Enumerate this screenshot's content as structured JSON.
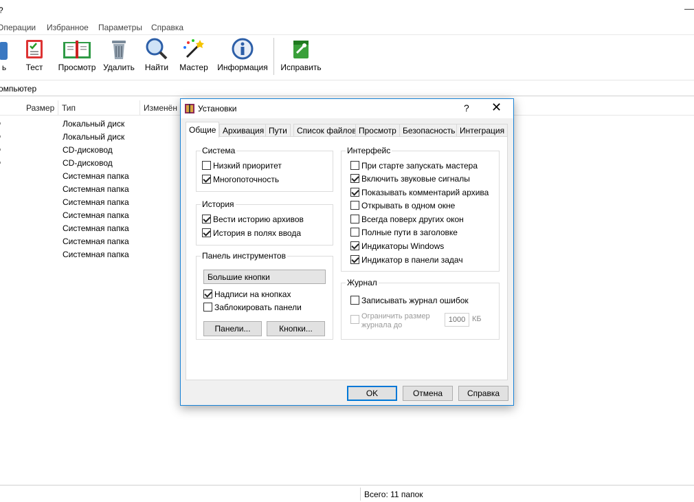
{
  "window": {
    "title_fragment": "?",
    "minimize_glyph": "—"
  },
  "menu": [
    "Операции",
    "Избранное",
    "Параметры",
    "Справка"
  ],
  "toolbar": {
    "partial_label": "ь",
    "buttons": [
      "Тест",
      "Просмотр",
      "Удалить",
      "Найти",
      "Мастер",
      "Информация",
      "Исправить"
    ]
  },
  "address": "омпьютер",
  "list": {
    "columns": [
      "Размер",
      "Тип",
      "Изменён"
    ],
    "rows": [
      "Локальный диск",
      "Локальный диск",
      "CD-дисковод",
      "CD-дисковод",
      "Системная папка",
      "Системная папка",
      "Системная папка",
      "Системная папка",
      "Системная папка",
      "Системная папка",
      "Системная папка"
    ]
  },
  "status": "Всего: 11 папок",
  "dialog": {
    "title": "Установки",
    "help": "?",
    "close": "✕",
    "tabs": [
      "Общие",
      "Архивация",
      "Пути",
      "Список файлов",
      "Просмотр",
      "Безопасность",
      "Интеграция"
    ],
    "active_tab": "Общие",
    "system": {
      "title": "Система",
      "options": [
        {
          "label": "Низкий приоритет",
          "checked": false
        },
        {
          "label": "Многопоточность",
          "checked": true
        }
      ]
    },
    "history": {
      "title": "История",
      "options": [
        {
          "label": "Вести историю архивов",
          "checked": true
        },
        {
          "label": "История в полях ввода",
          "checked": true
        }
      ]
    },
    "toolbar_panel": {
      "title": "Панель инструментов",
      "select_value": "Большие кнопки",
      "options": [
        {
          "label": "Надписи на кнопках",
          "checked": true
        },
        {
          "label": "Заблокировать панели",
          "checked": false
        }
      ],
      "panels_button": "Панели...",
      "buttons_button": "Кнопки..."
    },
    "interface": {
      "title": "Интерфейс",
      "options": [
        {
          "label": "При старте запускать мастера",
          "checked": false
        },
        {
          "label": "Включить звуковые сигналы",
          "checked": true
        },
        {
          "label": "Показывать комментарий архива",
          "checked": true
        },
        {
          "label": "Открывать в одном окне",
          "checked": false
        },
        {
          "label": "Всегда поверх других окон",
          "checked": false
        },
        {
          "label": "Полные пути в заголовке",
          "checked": false
        },
        {
          "label": "Индикаторы Windows",
          "checked": true
        },
        {
          "label": "Индикатор в панели задач",
          "checked": true
        }
      ]
    },
    "log": {
      "title": "Журнал",
      "write_log": {
        "label": "Записывать журнал ошибок",
        "checked": false
      },
      "limit_label_line1": "Ограничить размер",
      "limit_label_line2": "журнала до",
      "limit_value": "1000",
      "limit_unit": "КБ"
    },
    "buttons": {
      "ok": "OK",
      "cancel": "Отмена",
      "help": "Справка"
    }
  },
  "colors": {
    "accent": "#0078d7",
    "dialog_border": "#1883d7"
  }
}
